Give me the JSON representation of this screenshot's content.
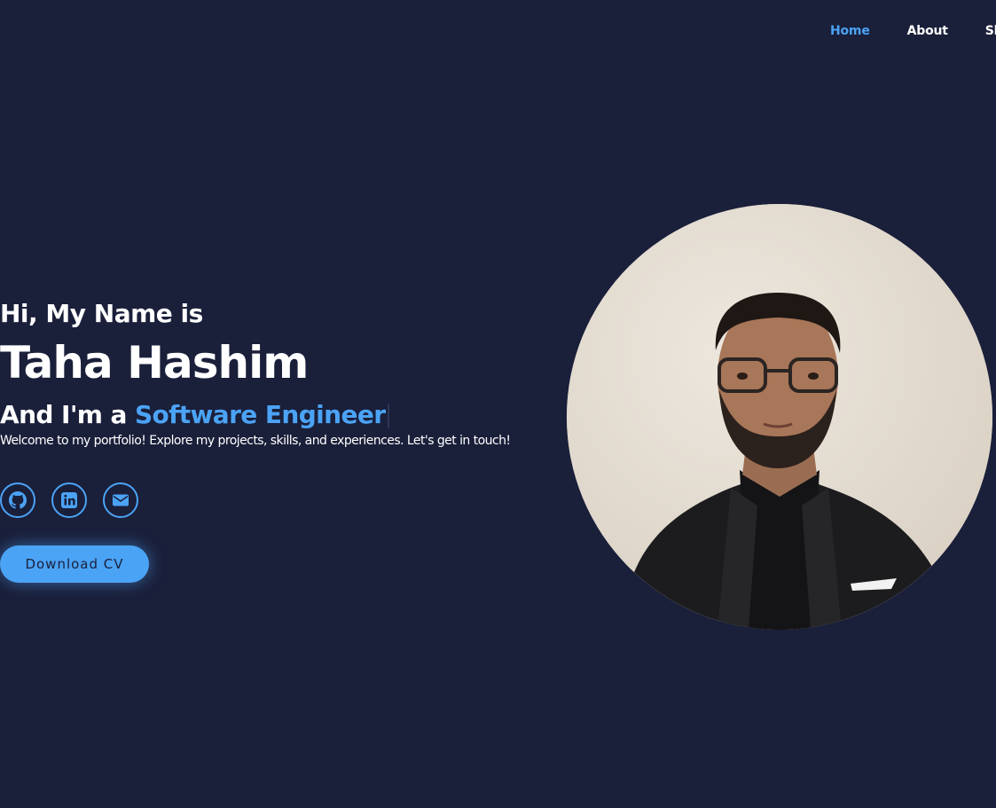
{
  "nav": {
    "items": [
      {
        "label": "Home",
        "active": true
      },
      {
        "label": "About",
        "active": false
      },
      {
        "label": "Sk",
        "active": false
      }
    ]
  },
  "hero": {
    "greeting": "Hi, My Name is",
    "name": "Taha Hashim",
    "role_prefix": "And I'm a ",
    "role": "Software Engineer",
    "tagline": "Welcome to my portfolio! Explore my projects, skills, and experiences. Let's get in touch!"
  },
  "socials": [
    {
      "icon": "github-icon"
    },
    {
      "icon": "linkedin-icon"
    },
    {
      "icon": "envelope-icon"
    }
  ],
  "cta": {
    "label": "Download CV"
  },
  "colors": {
    "background": "#1a1f3a",
    "accent": "#4ba3f5",
    "text": "#ffffff"
  }
}
